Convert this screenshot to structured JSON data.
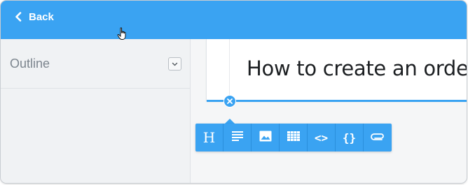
{
  "header": {
    "back_label": "Back",
    "back_icon": "chevron-left-icon",
    "background": "#3aa3f2"
  },
  "sidebar": {
    "title": "Outline",
    "toggle_icon": "chevron-down-icon"
  },
  "document": {
    "title": "How to create an order"
  },
  "block_controls": {
    "remove_icon": "close-icon",
    "accent": "#3aa3f2"
  },
  "toolbar": {
    "items": [
      {
        "name": "heading",
        "label": "H",
        "icon": "heading-icon"
      },
      {
        "name": "paragraph",
        "icon": "paragraph-icon"
      },
      {
        "name": "image",
        "icon": "image-icon"
      },
      {
        "name": "table",
        "icon": "table-icon"
      },
      {
        "name": "code",
        "label": "<>",
        "icon": "code-icon"
      },
      {
        "name": "json",
        "label": "{}",
        "icon": "braces-icon"
      },
      {
        "name": "attachment",
        "icon": "paperclip-icon"
      }
    ]
  }
}
